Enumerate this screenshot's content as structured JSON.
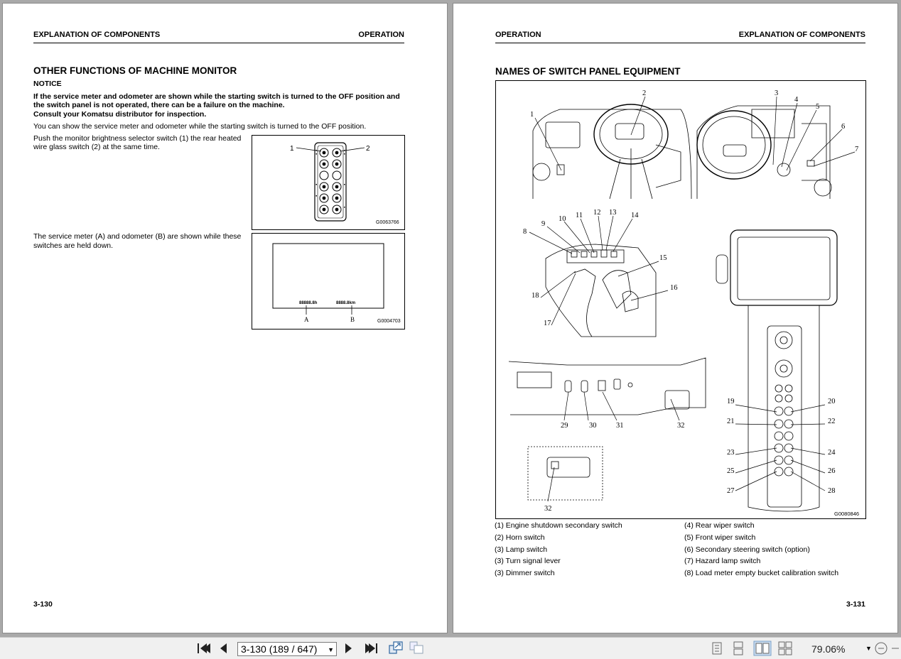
{
  "left_page": {
    "header_left": "EXPLANATION OF COMPONENTS",
    "header_right": "OPERATION",
    "title": "OTHER FUNCTIONS OF MACHINE MONITOR",
    "notice_label": "NOTICE",
    "notice_line1": "If the service meter and odometer are shown while the starting switch is turned to the OFF position and",
    "notice_line2": "the switch panel is not operated, there can be a failure on the machine.",
    "notice_line3": "Consult your Komatsu distributor for inspection.",
    "para1": "You can show the service meter and odometer while the starting switch is turned to the OFF position.",
    "para2_line1": "Push the monitor brightness selector switch (1) the rear heated",
    "para2_line2": "wire glass switch (2) at the same time.",
    "para3_line1": "The service meter (A) and odometer (B) are shown while these",
    "para3_line2": "switches are held down.",
    "fig1": {
      "code": "G0063766",
      "label1": "1",
      "label2": "2"
    },
    "fig2": {
      "code": "G0004703",
      "value_a": "88888.8h",
      "value_b": "8888.8km",
      "label_a": "A",
      "label_b": "B"
    },
    "page_number": "3-130"
  },
  "right_page": {
    "header_left": "OPERATION",
    "header_right": "EXPLANATION OF COMPONENTS",
    "title": "NAMES OF SWITCH PANEL EQUIPMENT",
    "fig_code": "G0080846",
    "callouts": [
      "1",
      "2",
      "3",
      "4",
      "5",
      "6",
      "7",
      "8",
      "9",
      "10",
      "11",
      "12",
      "13",
      "14",
      "15",
      "16",
      "17",
      "18",
      "19",
      "20",
      "21",
      "22",
      "23",
      "24",
      "25",
      "26",
      "27",
      "28",
      "29",
      "30",
      "31",
      "32",
      "32"
    ],
    "captions_left": [
      "(1) Engine shutdown secondary switch",
      "(2) Horn switch",
      "(3) Lamp switch",
      "(3) Turn signal lever",
      "(3) Dimmer switch"
    ],
    "captions_right": [
      "(4) Rear wiper switch",
      "(5) Front wiper switch",
      "(6) Secondary steering switch (option)",
      "(7) Hazard lamp switch",
      "(8) Load meter empty bucket calibration switch"
    ],
    "page_number": "3-131"
  },
  "toolbar": {
    "page_field": "3-130 (189 / 647)",
    "zoom": "79.06%",
    "icons": [
      "first-page-icon",
      "prev-page-icon",
      "next-page-icon",
      "last-page-icon",
      "go-back-view-icon",
      "go-forward-view-icon",
      "single-page-view-icon",
      "continuous-view-icon",
      "two-page-view-icon",
      "two-page-continuous-view-icon",
      "zoom-out-icon"
    ]
  }
}
